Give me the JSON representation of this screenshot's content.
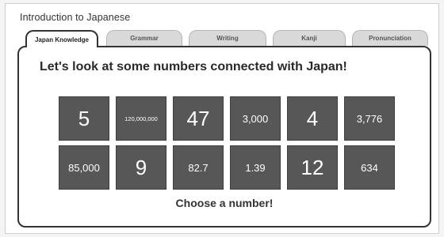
{
  "window": {
    "title": "Introduction to Japanese"
  },
  "tabs": [
    {
      "label": "Japan Knowledge",
      "active": true
    },
    {
      "label": "Grammar",
      "active": false
    },
    {
      "label": "Writing",
      "active": false
    },
    {
      "label": "Kanji",
      "active": false
    },
    {
      "label": "Pronunciation",
      "active": false
    }
  ],
  "main": {
    "heading": "Let's look at some numbers connected with Japan!",
    "numbers": [
      {
        "label": "5",
        "size": "xl"
      },
      {
        "label": "120,000,000",
        "size": "sm"
      },
      {
        "label": "47",
        "size": "xl"
      },
      {
        "label": "3,000",
        "size": "md"
      },
      {
        "label": "4",
        "size": "xl"
      },
      {
        "label": "3,776",
        "size": "md"
      },
      {
        "label": "85,000",
        "size": "md"
      },
      {
        "label": "9",
        "size": "xl"
      },
      {
        "label": "82.7",
        "size": "md"
      },
      {
        "label": "1.39",
        "size": "md"
      },
      {
        "label": "12",
        "size": "xl"
      },
      {
        "label": "634",
        "size": "md"
      }
    ],
    "prompt": "Choose a number!"
  },
  "colors": {
    "tile": "#575757",
    "tab_inactive": "#d9d9d9",
    "panel_border": "#333333"
  }
}
